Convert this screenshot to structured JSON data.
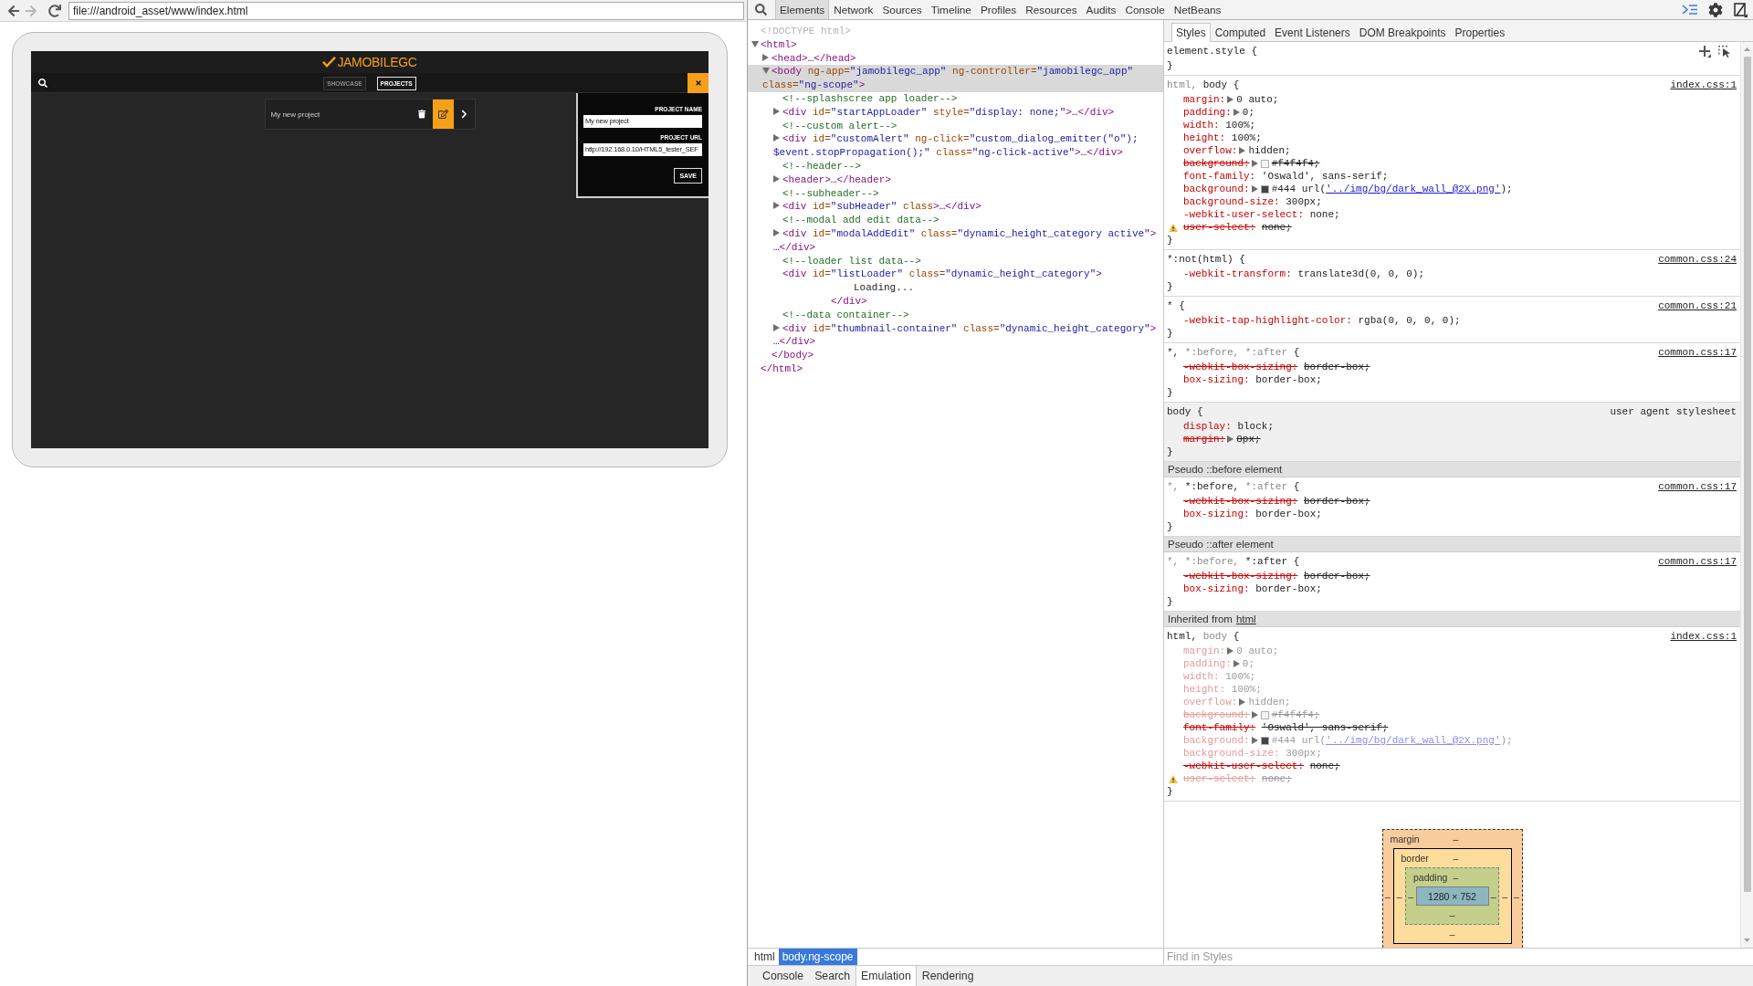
{
  "browser": {
    "nav": [
      {
        "kind": "back",
        "disabled": false
      },
      {
        "kind": "forward",
        "disabled": true
      },
      {
        "kind": "reload",
        "disabled": false
      }
    ],
    "url": "file:///android_asset/www/index.html"
  },
  "app": {
    "logo": "JAMOBILEGC",
    "tabs": [
      {
        "label": "SHOWCASE",
        "selected": false
      },
      {
        "label": "PROJECTS",
        "selected": true
      }
    ],
    "projects": [
      {
        "name": "My new project",
        "editing": true
      }
    ],
    "editor": {
      "fields": [
        {
          "label": "PROJECT NAME",
          "value": "My new project"
        },
        {
          "label": "PROJECT URL",
          "value": "http://192.168.0.10/HTML5_tester_SEF"
        }
      ],
      "save": "SAVE"
    }
  },
  "devtools": {
    "tabs": [
      {
        "label": "Elements",
        "selected": true
      },
      {
        "label": "Network",
        "selected": false
      },
      {
        "label": "Sources",
        "selected": false
      },
      {
        "label": "Timeline",
        "selected": false
      },
      {
        "label": "Profiles",
        "selected": false
      },
      {
        "label": "Resources",
        "selected": false
      },
      {
        "label": "Audits",
        "selected": false
      },
      {
        "label": "Console",
        "selected": false
      },
      {
        "label": "NetBeans",
        "selected": false
      }
    ],
    "drawer_open": true,
    "dom_tree": [
      {
        "kind": "doctype",
        "selected": false,
        "text": "<!DOCTYPE html>"
      },
      {
        "kind": "element",
        "expanded": true,
        "selected": false,
        "open": {
          "tag": "<html",
          "end": ">"
        },
        "children": [
          {
            "kind": "element",
            "expanded": false,
            "selected": false,
            "open": {
              "tag": "<head",
              "end": ">"
            },
            "ellipsis": "…",
            "close": "</head>"
          },
          {
            "kind": "element",
            "expanded": true,
            "selected": true,
            "open": {
              "tag": "<body",
              "attrs": [
                {
                  "name": "ng-app=",
                  "value": "\"jamobilegc_app\""
                },
                {
                  "name": "ng-controller=",
                  "value": "\"jamobilegc_app\""
                },
                {
                  "name": "class=",
                  "value": "\"ng-scope\""
                }
              ],
              "end": ">"
            },
            "children": [
              {
                "kind": "comment",
                "selected": false,
                "text": "<!--splashscree app loader-->"
              },
              {
                "kind": "element",
                "expanded": false,
                "selected": false,
                "open": {
                  "tag": "<div",
                  "attrs": [
                    {
                      "name": "id=",
                      "value": "\"startAppLoader\""
                    },
                    {
                      "name": "style=",
                      "value": "\"display: none;\""
                    }
                  ],
                  "end": ">"
                },
                "ellipsis": "…",
                "close": "</div>"
              },
              {
                "kind": "comment",
                "selected": false,
                "text": "<!--custom alert-->"
              },
              {
                "kind": "element",
                "expanded": false,
                "selected": false,
                "open": {
                  "tag": "<div",
                  "attrs": [
                    {
                      "name": "id=",
                      "value": "\"customAlert\""
                    },
                    {
                      "name": "ng-click=",
                      "value": "\"custom_dialog_emitter(\"o\"); $event.stopPropagation();\""
                    },
                    {
                      "name": "class=",
                      "value": "\"ng-click-active\""
                    }
                  ],
                  "end": ">"
                },
                "ellipsis": "…",
                "close": "</div>"
              },
              {
                "kind": "comment",
                "selected": false,
                "text": "<!--header-->"
              },
              {
                "kind": "element",
                "expanded": false,
                "selected": false,
                "open": {
                  "tag": "<header",
                  "end": ">"
                },
                "ellipsis": "…",
                "close": "</header>"
              },
              {
                "kind": "comment",
                "selected": false,
                "text": "<!--subheader-->"
              },
              {
                "kind": "element",
                "expanded": false,
                "selected": false,
                "open": {
                  "tag": "<div",
                  "attrs": [
                    {
                      "name": "id=",
                      "value": "\"subHeader\""
                    },
                    {
                      "name": "class"
                    }
                  ],
                  "end": ">"
                },
                "ellipsis": "…",
                "close": "</div>"
              },
              {
                "kind": "comment",
                "selected": false,
                "text": "<!--modal add edit data-->"
              },
              {
                "kind": "element",
                "expanded": false,
                "selected": false,
                "open": {
                  "tag": "<div",
                  "attrs": [
                    {
                      "name": "id=",
                      "value": "\"modalAddEdit\""
                    },
                    {
                      "name": "class=",
                      "value": "\"dynamic_height_category active\""
                    }
                  ],
                  "end": ">"
                },
                "ellipsis": "…",
                "close": "</div>"
              },
              {
                "kind": "comment",
                "selected": false,
                "text": "<!--loader list data-->"
              },
              {
                "kind": "element",
                "selected": false,
                "open": {
                  "tag": "<div",
                  "attrs": [
                    {
                      "name": "id=",
                      "value": "\"listLoader\""
                    },
                    {
                      "name": "class=",
                      "value": "\"dynamic_height_category\""
                    }
                  ],
                  "end": ">"
                },
                "children": [
                  {
                    "kind": "text",
                    "selected": false,
                    "text": "Loading..."
                  }
                ],
                "close": "</div>"
              },
              {
                "kind": "comment",
                "selected": false,
                "text": "<!--data container-->"
              },
              {
                "kind": "element",
                "expanded": false,
                "selected": false,
                "open": {
                  "tag": "<div",
                  "attrs": [
                    {
                      "name": "id=",
                      "value": "\"thumbnail-container\""
                    },
                    {
                      "name": "class=",
                      "value": "\"dynamic_height_category\""
                    }
                  ],
                  "end": ">"
                },
                "ellipsis": "…",
                "close": "</div>"
              }
            ],
            "close": "</body>"
          }
        ],
        "close": "</html>"
      }
    ],
    "breadcrumbs": [
      {
        "label": "html",
        "selected": false
      },
      {
        "label": "body.ng-scope",
        "selected": true
      }
    ],
    "sidebar_tabs": [
      {
        "label": "Styles",
        "selected": true
      },
      {
        "label": "Computed",
        "selected": false
      },
      {
        "label": "Event Listeners",
        "selected": false
      },
      {
        "label": "DOM Breakpoints",
        "selected": false
      },
      {
        "label": "Properties",
        "selected": false
      }
    ],
    "style_sections": [
      {
        "kind": "inline",
        "selector": [
          {
            "text": "element.style",
            "matched": true
          }
        ],
        "brace": "{",
        "closing": "}"
      },
      {
        "kind": "rule",
        "read_only": false,
        "selector": [
          {
            "text": "html,",
            "matched": false
          },
          {
            "text": "body",
            "matched": true
          }
        ],
        "brace": "{",
        "source": "index.css:1",
        "source_link": true,
        "declarations": [
          {
            "name": "margin:",
            "value": "0 auto;",
            "expandable": true,
            "overridden": false,
            "inactive": false,
            "warning": false
          },
          {
            "name": "padding:",
            "value": "0;",
            "expandable": true,
            "overridden": false,
            "inactive": false,
            "warning": false
          },
          {
            "name": "width:",
            "value": "100%;",
            "expandable": false,
            "overridden": false,
            "inactive": false,
            "warning": false
          },
          {
            "name": "height:",
            "value": "100%;",
            "expandable": false,
            "overridden": false,
            "inactive": false,
            "warning": false
          },
          {
            "name": "overflow:",
            "value": "hidden;",
            "expandable": true,
            "overridden": false,
            "inactive": false,
            "warning": false
          },
          {
            "name": "background:",
            "value": "#f4f4f4;",
            "color": "#f4f4f4",
            "expandable": true,
            "overridden": true,
            "inactive": false,
            "warning": false
          },
          {
            "name": "font-family:",
            "value": "'Oswald', sans-serif;",
            "expandable": false,
            "overridden": false,
            "inactive": false,
            "warning": false
          },
          {
            "name": "background:",
            "value": "#444 url(",
            "link": "'../img/bg/dark_wall_@2X.png'",
            "value_end": ");",
            "color": "#444444",
            "expandable": true,
            "overridden": false,
            "inactive": false,
            "warning": false
          },
          {
            "name": "background-size:",
            "value": "300px;",
            "expandable": false,
            "overridden": false,
            "inactive": false,
            "warning": false
          },
          {
            "name": "-webkit-user-select:",
            "value": "none;",
            "expandable": false,
            "overridden": false,
            "inactive": false,
            "warning": false
          },
          {
            "name": "user-select:",
            "value": "none;",
            "expandable": false,
            "overridden": true,
            "inactive": false,
            "warning": true
          }
        ],
        "closing": "}"
      },
      {
        "kind": "rule",
        "read_only": false,
        "selector": [
          {
            "text": "*:not(html)",
            "matched": true
          }
        ],
        "brace": "{",
        "source": "common.css:24",
        "source_link": true,
        "declarations": [
          {
            "name": "-webkit-transform:",
            "value": "translate3d(0, 0, 0);",
            "expandable": false,
            "overridden": false,
            "inactive": false,
            "warning": false
          }
        ],
        "closing": "}"
      },
      {
        "kind": "rule",
        "read_only": false,
        "selector": [
          {
            "text": "*",
            "matched": true
          }
        ],
        "brace": "{",
        "source": "common.css:21",
        "source_link": true,
        "declarations": [
          {
            "name": "-webkit-tap-highlight-color:",
            "value": "rgba(0, 0, 0, 0);",
            "expandable": false,
            "overridden": false,
            "inactive": false,
            "warning": false
          }
        ],
        "closing": "}"
      },
      {
        "kind": "rule",
        "read_only": false,
        "selector": [
          {
            "text": "*,",
            "matched": true
          },
          {
            "text": "*:before,",
            "matched": false
          },
          {
            "text": "*:after",
            "matched": false
          }
        ],
        "brace": "{",
        "source": "common.css:17",
        "source_link": true,
        "declarations": [
          {
            "name": "-webkit-box-sizing:",
            "value": "border-box;",
            "expandable": false,
            "overridden": true,
            "inactive": false,
            "warning": false
          },
          {
            "name": "box-sizing:",
            "value": "border-box;",
            "expandable": false,
            "overridden": false,
            "inactive": false,
            "warning": false
          }
        ],
        "closing": "}"
      },
      {
        "kind": "rule",
        "read_only": true,
        "selector": [
          {
            "text": "body",
            "matched": true
          }
        ],
        "brace": "{",
        "source": "user agent stylesheet",
        "source_link": false,
        "declarations": [
          {
            "name": "display:",
            "value": "block;",
            "expandable": false,
            "overridden": false,
            "inactive": false,
            "warning": false
          },
          {
            "name": "margin:",
            "value": "8px;",
            "expandable": true,
            "overridden": true,
            "inactive": false,
            "warning": false
          }
        ],
        "closing": "}"
      },
      {
        "kind": "header",
        "label": "Pseudo ::before element"
      },
      {
        "kind": "rule",
        "read_only": false,
        "selector": [
          {
            "text": "*,",
            "matched": false
          },
          {
            "text": "*:before,",
            "matched": true
          },
          {
            "text": "*:after",
            "matched": false
          }
        ],
        "brace": "{",
        "source": "common.css:17",
        "source_link": true,
        "declarations": [
          {
            "name": "-webkit-box-sizing:",
            "value": "border-box;",
            "expandable": false,
            "overridden": true,
            "inactive": false,
            "warning": false
          },
          {
            "name": "box-sizing:",
            "value": "border-box;",
            "expandable": false,
            "overridden": false,
            "inactive": false,
            "warning": false
          }
        ],
        "closing": "}"
      },
      {
        "kind": "header",
        "label": "Pseudo ::after element"
      },
      {
        "kind": "rule",
        "read_only": false,
        "selector": [
          {
            "text": "*,",
            "matched": false
          },
          {
            "text": "*:before,",
            "matched": false
          },
          {
            "text": "*:after",
            "matched": true
          }
        ],
        "brace": "{",
        "source": "common.css:17",
        "source_link": true,
        "declarations": [
          {
            "name": "-webkit-box-sizing:",
            "value": "border-box;",
            "expandable": false,
            "overridden": true,
            "inactive": false,
            "warning": false
          },
          {
            "name": "box-sizing:",
            "value": "border-box;",
            "expandable": false,
            "overridden": false,
            "inactive": false,
            "warning": false
          }
        ],
        "closing": "}"
      },
      {
        "kind": "header",
        "label": "Inherited from",
        "link": "html"
      },
      {
        "kind": "rule",
        "read_only": false,
        "selector": [
          {
            "text": "html,",
            "matched": true
          },
          {
            "text": "body",
            "matched": false
          }
        ],
        "brace": "{",
        "source": "index.css:1",
        "source_link": true,
        "declarations": [
          {
            "name": "margin:",
            "value": "0 auto;",
            "expandable": true,
            "overridden": false,
            "inactive": true,
            "warning": false
          },
          {
            "name": "padding:",
            "value": "0;",
            "expandable": true,
            "overridden": false,
            "inactive": true,
            "warning": false
          },
          {
            "name": "width:",
            "value": "100%;",
            "expandable": false,
            "overridden": false,
            "inactive": true,
            "warning": false
          },
          {
            "name": "height:",
            "value": "100%;",
            "expandable": false,
            "overridden": false,
            "inactive": true,
            "warning": false
          },
          {
            "name": "overflow:",
            "value": "hidden;",
            "expandable": true,
            "overridden": false,
            "inactive": true,
            "warning": false
          },
          {
            "name": "background:",
            "value": "#f4f4f4;",
            "color": "#f4f4f4",
            "expandable": true,
            "overridden": true,
            "inactive": true,
            "warning": false
          },
          {
            "name": "font-family:",
            "value": "'Oswald', sans-serif;",
            "expandable": false,
            "overridden": true,
            "inactive": false,
            "warning": false
          },
          {
            "name": "background:",
            "value": "#444 url(",
            "link": "'../img/bg/dark_wall_@2X.png'",
            "value_end": ");",
            "color": "#444444",
            "expandable": true,
            "overridden": false,
            "inactive": true,
            "warning": false
          },
          {
            "name": "background-size:",
            "value": "300px;",
            "expandable": false,
            "overridden": false,
            "inactive": true,
            "warning": false
          },
          {
            "name": "-webkit-user-select:",
            "value": "none;",
            "expandable": false,
            "overridden": true,
            "inactive": false,
            "warning": false
          },
          {
            "name": "user-select:",
            "value": "none;",
            "expandable": false,
            "overridden": true,
            "inactive": true,
            "warning": true
          }
        ],
        "closing": "}"
      }
    ],
    "box_model": {
      "kind": "margin",
      "label": "margin",
      "top": "‒",
      "left": "‒",
      "inner": {
        "kind": "border",
        "label": "border",
        "top": "‒",
        "left": "‒",
        "inner": {
          "kind": "padding",
          "label": "padding",
          "top": "‒",
          "left": "‒",
          "inner": {
            "kind": "content",
            "text": "1280 × 752"
          },
          "right": "‒",
          "bottom": "‒"
        },
        "right": "‒",
        "bottom": "‒"
      },
      "right": "‒"
    },
    "find_placeholder": "Find in Styles",
    "drawer_tabs": [
      {
        "label": "Console",
        "selected": false
      },
      {
        "label": "Search",
        "selected": false
      },
      {
        "label": "Emulation",
        "selected": true
      },
      {
        "label": "Rendering",
        "selected": false
      }
    ]
  }
}
